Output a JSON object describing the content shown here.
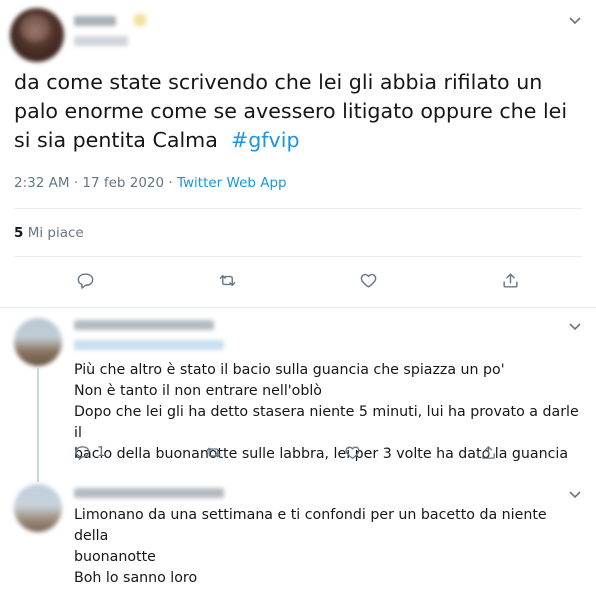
{
  "main_tweet": {
    "author_avatar": "blurred-avatar",
    "text": "da come state scrivendo che lei gli abbia rifilato un palo enorme come se avessero litigato oppure che lei si sia pentita Calma",
    "hashtag": "#gfvip",
    "timestamp": "2:32 AM · 17 feb 2020 · ",
    "source": "Twitter Web App",
    "likes_count": "5",
    "likes_label": "Mi piace"
  },
  "replies": [
    {
      "avatar": "blurred-avatar",
      "lines": [
        "Più che altro è stato il bacio sulla guancia che spiazza un po'",
        "Non è tanto il non entrare nell'oblò",
        "Dopo che lei gli ha detto stasera niente 5 minuti, lui ha provato a darle il",
        "bacio della buonanotte sulle labbra, lei per 3 volte ha dato la guancia"
      ],
      "reply_count": "1"
    },
    {
      "avatar": "blurred-avatar",
      "lines": [
        "Limonano da una settimana e ti confondi per un bacetto da niente della",
        "buonanotte",
        "Boh lo sanno loro"
      ]
    }
  ],
  "icons": {
    "chevron": "chevron-down-icon",
    "reply": "reply-icon",
    "retweet": "retweet-icon",
    "like": "heart-icon",
    "share": "share-icon"
  },
  "colors": {
    "link": "#1b95e0",
    "secondary_text": "#657786",
    "divider": "#e6ecf0"
  }
}
